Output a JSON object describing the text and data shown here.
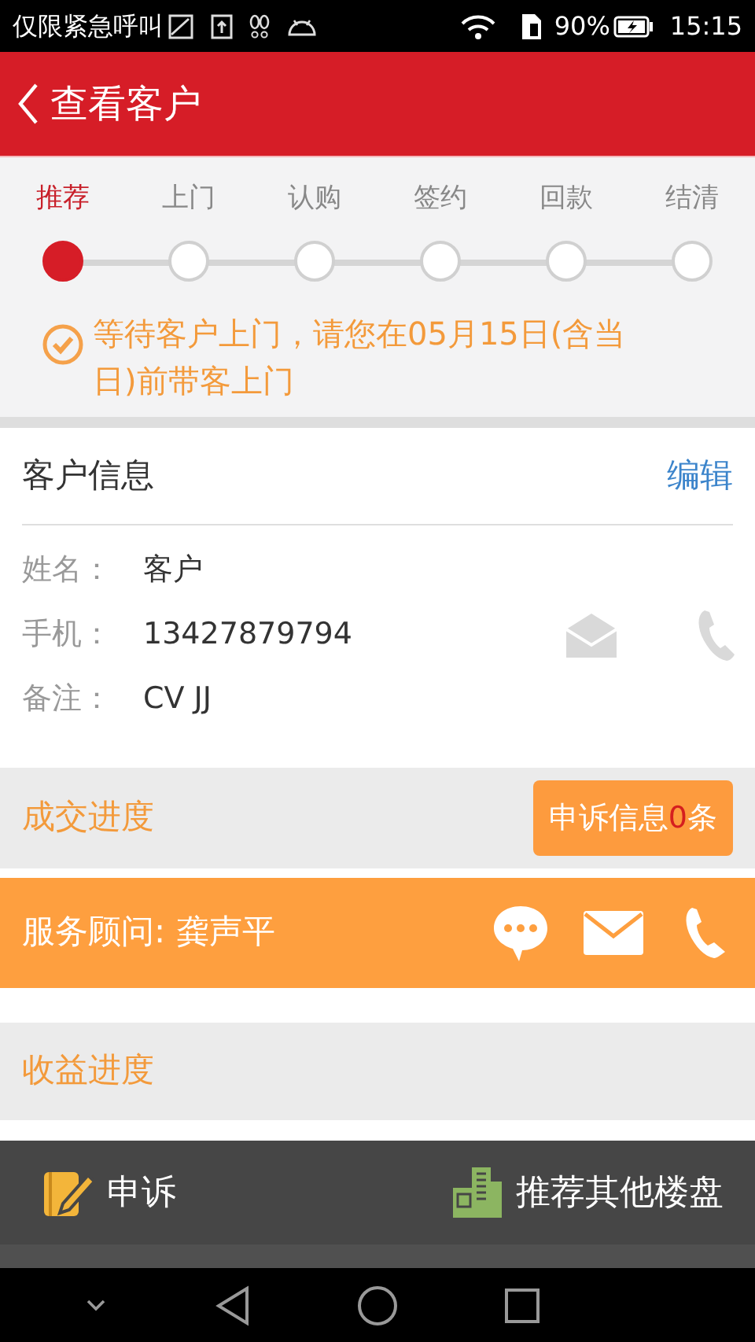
{
  "status_bar": {
    "carrier": "仅限紧急呼叫",
    "battery": "90%",
    "time": "15:15"
  },
  "header": {
    "title": "查看客户"
  },
  "steps": [
    {
      "label": "推荐",
      "selected": true
    },
    {
      "label": "上门",
      "selected": false
    },
    {
      "label": "认购",
      "selected": false
    },
    {
      "label": "签约",
      "selected": false
    },
    {
      "label": "回款",
      "selected": false
    },
    {
      "label": "结清",
      "selected": false
    }
  ],
  "notice": "等待客户上门，请您在05月15日(含当日)前带客上门",
  "customer_info": {
    "title": "客户信息",
    "edit": "编辑",
    "fields": [
      {
        "label": "姓名：",
        "value": "客户"
      },
      {
        "label": "手机：",
        "value": "13427879794"
      },
      {
        "label": "备注：",
        "value": "CV JJ"
      }
    ]
  },
  "deal_progress": {
    "title": "成交进度",
    "complaint_prefix": "申诉信息",
    "complaint_count": "0",
    "complaint_suffix": "条"
  },
  "advisor": {
    "label": "服务顾问: 龚声平"
  },
  "income_progress": {
    "title": "收益进度"
  },
  "bottom_bar": [
    {
      "kind": "complaint",
      "label": "申诉"
    },
    {
      "kind": "recommend",
      "label": "推荐其他楼盘"
    }
  ]
}
